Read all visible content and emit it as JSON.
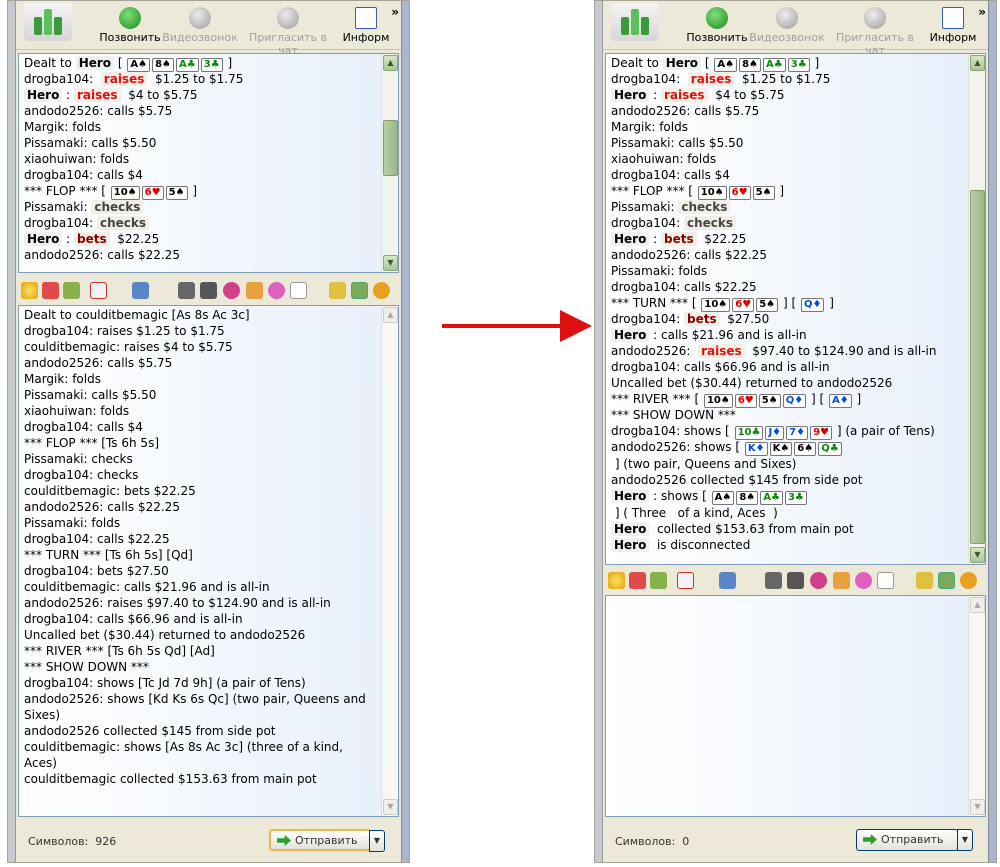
{
  "toolbar": {
    "call": "Позвонить",
    "video": "Видеозвонок",
    "invite": "Пригласить в чат",
    "info": "Информ",
    "more": "»"
  },
  "left": {
    "log": [
      {
        "parts": [
          {
            "t": "Dealt to "
          },
          {
            "h": "Hero"
          },
          {
            "t": " [ "
          },
          {
            "c": "A♠",
            "k": "s"
          },
          {
            "c": "8♠",
            "k": "s"
          },
          {
            "c": "A♣",
            "k": "cl"
          },
          {
            "c": "3♣",
            "k": "cl"
          },
          {
            "t": " ]"
          }
        ]
      },
      {
        "parts": [
          {
            "t": "drogba104:  "
          },
          {
            "a": "raises",
            "k": "raise"
          },
          {
            "t": "  $1.25 to $1.75"
          }
        ]
      },
      {
        "parts": [
          {
            "h": "Hero"
          },
          {
            "t": " : "
          },
          {
            "a": "raises",
            "k": "raise"
          },
          {
            "t": "  $4 to $5.75"
          }
        ]
      },
      {
        "parts": [
          {
            "t": "andodo2526: calls $5.75"
          }
        ]
      },
      {
        "parts": [
          {
            "t": "Margik: folds"
          }
        ]
      },
      {
        "parts": [
          {
            "t": "Pissamaki: calls $5.50"
          }
        ]
      },
      {
        "parts": [
          {
            "t": "xiaohuiwan: folds"
          }
        ]
      },
      {
        "parts": [
          {
            "t": "drogba104: calls $4"
          }
        ]
      },
      {
        "parts": [
          {
            "t": "*** FLOP *** [ "
          },
          {
            "c": "10♠",
            "k": "s"
          },
          {
            "c": "6♥",
            "k": "h"
          },
          {
            "c": "5♠",
            "k": "s"
          },
          {
            "t": " ]"
          }
        ]
      },
      {
        "parts": [
          {
            "t": "Pissamaki: "
          },
          {
            "a": "checks",
            "k": "chk"
          }
        ]
      },
      {
        "parts": [
          {
            "t": "drogba104: "
          },
          {
            "a": "checks",
            "k": "chk"
          }
        ]
      },
      {
        "parts": [
          {
            "h": "Hero"
          },
          {
            "t": " : "
          },
          {
            "a": "bets",
            "k": "bet"
          },
          {
            "t": "  $22.25"
          }
        ]
      },
      {
        "parts": [
          {
            "t": "andodo2526: calls $22.25"
          }
        ]
      }
    ],
    "input": [
      "Dealt to coulditbemagic [As 8s Ac 3c]",
      "drogba104: raises $1.25 to $1.75",
      "coulditbemagic: raises $4 to $5.75",
      "andodo2526: calls $5.75",
      "Margik: folds",
      "Pissamaki: calls $5.50",
      "xiaohuiwan: folds",
      "drogba104: calls $4",
      "*** FLOP *** [Ts 6h 5s]",
      "Pissamaki: checks",
      "drogba104: checks",
      "coulditbemagic: bets $22.25",
      "andodo2526: calls $22.25",
      "Pissamaki: folds",
      "drogba104: calls $22.25",
      "*** TURN *** [Ts 6h 5s] [Qd]",
      "drogba104: bets $27.50",
      "coulditbemagic: calls $21.96 and is all-in",
      "andodo2526: raises $97.40 to $124.90 and is all-in",
      "drogba104: calls $66.96 and is all-in",
      "Uncalled bet ($30.44) returned to andodo2526",
      "*** RIVER *** [Ts 6h 5s Qd] [Ad]",
      "*** SHOW DOWN ***",
      "drogba104: shows [Tc Jd 7d 9h] (a pair of Tens)",
      "andodo2526: shows [Kd Ks 6s Qc] (two pair, Queens and Sixes)",
      "andodo2526 collected $145 from side pot",
      "coulditbemagic: shows [As 8s Ac 3c] (three of a kind, Aces)",
      "coulditbemagic collected $153.63 from main pot"
    ],
    "chars_label": "Символов:",
    "chars": "926",
    "send": "Отправить"
  },
  "right": {
    "log": [
      {
        "parts": [
          {
            "t": "Dealt to "
          },
          {
            "h": "Hero"
          },
          {
            "t": " [ "
          },
          {
            "c": "A♠",
            "k": "s"
          },
          {
            "c": "8♠",
            "k": "s"
          },
          {
            "c": "A♣",
            "k": "cl"
          },
          {
            "c": "3♣",
            "k": "cl"
          },
          {
            "t": " ]"
          }
        ]
      },
      {
        "parts": [
          {
            "t": "drogba104:  "
          },
          {
            "a": "raises",
            "k": "raise"
          },
          {
            "t": "  $1.25 to $1.75"
          }
        ]
      },
      {
        "parts": [
          {
            "h": "Hero"
          },
          {
            "t": " : "
          },
          {
            "a": "raises",
            "k": "raise"
          },
          {
            "t": "  $4 to $5.75"
          }
        ]
      },
      {
        "parts": [
          {
            "t": "andodo2526: calls $5.75"
          }
        ]
      },
      {
        "parts": [
          {
            "t": "Margik: folds"
          }
        ]
      },
      {
        "parts": [
          {
            "t": "Pissamaki: calls $5.50"
          }
        ]
      },
      {
        "parts": [
          {
            "t": "xiaohuiwan: folds"
          }
        ]
      },
      {
        "parts": [
          {
            "t": "drogba104: calls $4"
          }
        ]
      },
      {
        "parts": [
          {
            "t": "*** FLOP *** [ "
          },
          {
            "c": "10♠",
            "k": "s"
          },
          {
            "c": "6♥",
            "k": "h"
          },
          {
            "c": "5♠",
            "k": "s"
          },
          {
            "t": " ]"
          }
        ]
      },
      {
        "parts": [
          {
            "t": "Pissamaki: "
          },
          {
            "a": "checks",
            "k": "chk"
          }
        ]
      },
      {
        "parts": [
          {
            "t": "drogba104: "
          },
          {
            "a": "checks",
            "k": "chk"
          }
        ]
      },
      {
        "parts": [
          {
            "h": "Hero"
          },
          {
            "t": " : "
          },
          {
            "a": "bets",
            "k": "bet"
          },
          {
            "t": "  $22.25"
          }
        ]
      },
      {
        "parts": [
          {
            "t": "andodo2526: calls $22.25"
          }
        ]
      },
      {
        "parts": [
          {
            "t": "Pissamaki: folds"
          }
        ]
      },
      {
        "parts": [
          {
            "t": "drogba104: calls $22.25"
          }
        ]
      },
      {
        "parts": [
          {
            "t": "*** TURN *** [ "
          },
          {
            "c": "10♠",
            "k": "s"
          },
          {
            "c": "6♥",
            "k": "h"
          },
          {
            "c": "5♠",
            "k": "s"
          },
          {
            "t": " ] [ "
          },
          {
            "c": "Q♦",
            "k": "d"
          },
          {
            "t": " ]"
          }
        ]
      },
      {
        "parts": [
          {
            "t": "drogba104: "
          },
          {
            "a": "bets",
            "k": "bet"
          },
          {
            "t": "  $27.50"
          }
        ]
      },
      {
        "parts": [
          {
            "h": "Hero"
          },
          {
            "t": " : calls $21.96 and is all-in"
          }
        ]
      },
      {
        "parts": [
          {
            "t": "andodo2526:  "
          },
          {
            "a": "raises",
            "k": "raise"
          },
          {
            "t": "  $97.40 to $124.90 and is all-in"
          }
        ]
      },
      {
        "parts": [
          {
            "t": "drogba104: calls $66.96 and is all-in"
          }
        ]
      },
      {
        "parts": [
          {
            "t": "Uncalled bet ($30.44) returned to andodo2526"
          }
        ]
      },
      {
        "parts": [
          {
            "t": "*** RIVER *** [ "
          },
          {
            "c": "10♠",
            "k": "s"
          },
          {
            "c": "6♥",
            "k": "h"
          },
          {
            "c": "5♠",
            "k": "s"
          },
          {
            "c": "Q♦",
            "k": "d"
          },
          {
            "t": " ] [ "
          },
          {
            "c": "A♦",
            "k": "d"
          },
          {
            "t": " ]"
          }
        ]
      },
      {
        "parts": [
          {
            "t": "*** SHOW DOWN ***"
          }
        ]
      },
      {
        "parts": [
          {
            "t": "drogba104: shows [ "
          },
          {
            "c": "10♣",
            "k": "cl"
          },
          {
            "c": "J♦",
            "k": "d"
          },
          {
            "c": "7♦",
            "k": "d"
          },
          {
            "c": "9♥",
            "k": "h"
          },
          {
            "t": " ] (a pair of Tens)"
          }
        ]
      },
      {
        "wrap": true,
        "parts": [
          {
            "t": "andodo2526: shows [ "
          },
          {
            "c": "K♦",
            "k": "d"
          },
          {
            "c": "K♠",
            "k": "s"
          },
          {
            "c": "6♠",
            "k": "s"
          },
          {
            "c": "Q♣",
            "k": "cl"
          },
          {
            "t": " ] (two pair, Queens and Sixes)"
          }
        ]
      },
      {
        "parts": [
          {
            "t": "andodo2526 collected $145 from side pot"
          }
        ]
      },
      {
        "wrap": true,
        "parts": [
          {
            "h": "Hero"
          },
          {
            "t": " : shows [ "
          },
          {
            "c": "A♠",
            "k": "s"
          },
          {
            "c": "8♠",
            "k": "s"
          },
          {
            "c": "A♣",
            "k": "cl"
          },
          {
            "c": "3♣",
            "k": "cl"
          },
          {
            "t": " ] ( Three   of a kind, Aces  )"
          }
        ]
      },
      {
        "parts": [
          {
            "h": "Hero"
          },
          {
            "t": "  collected $153.63 from main pot"
          }
        ]
      },
      {
        "parts": [
          {
            "h": "Hero"
          },
          {
            "t": "  is disconnected"
          }
        ]
      }
    ],
    "chars_label": "Символов:",
    "chars": "0",
    "send": "Отправить"
  },
  "colors": {
    "arrow": "#e01010",
    "accent": "#2aa02a"
  }
}
